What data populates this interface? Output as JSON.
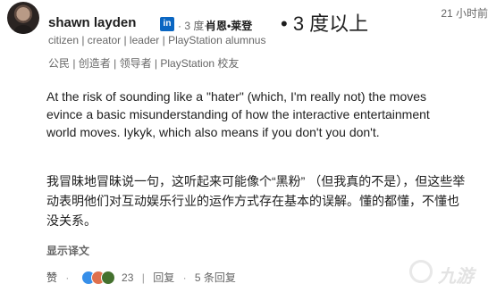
{
  "post": {
    "author": {
      "name": "shawn layden",
      "badge": "in",
      "degree": "· 3 度+",
      "name_cn": "肖恩•莱登",
      "degree_cn": "• 3 度以上",
      "headline": "citizen | creator | leader | PlayStation alumnus",
      "headline_cn": "公民 | 创造者 | 领导者 | PlayStation 校友"
    },
    "time": "21 小时前",
    "more_label": "...",
    "text_en": "At the risk of sounding like a \"hater\" (which, I'm really not) the moves evince a basic misunderstanding of how the interactive entertainment world moves. Iykyk, which also means if you don't you don't.",
    "text_cn": "我冒昧地冒昧说一句，这听起来可能像个“黑粉” （但我真的不是），但这些举动表明他们对互动娱乐行业的运作方式存在基本的误解。懂的都懂，不懂也没关系。",
    "translate_label": "显示译文",
    "actions": {
      "like_label": "赞",
      "reaction_count": "23",
      "reply_label": "回复",
      "reply_count": "5 条回复"
    },
    "reactions": [
      {
        "icon": "like-reaction-icon",
        "color": "#378fe9"
      },
      {
        "icon": "love-reaction-icon",
        "color": "#df704d"
      },
      {
        "icon": "support-reaction-icon",
        "color": "#44712e"
      }
    ]
  },
  "watermark": {
    "text": "九游",
    "icon": "watermark-logo-icon"
  }
}
